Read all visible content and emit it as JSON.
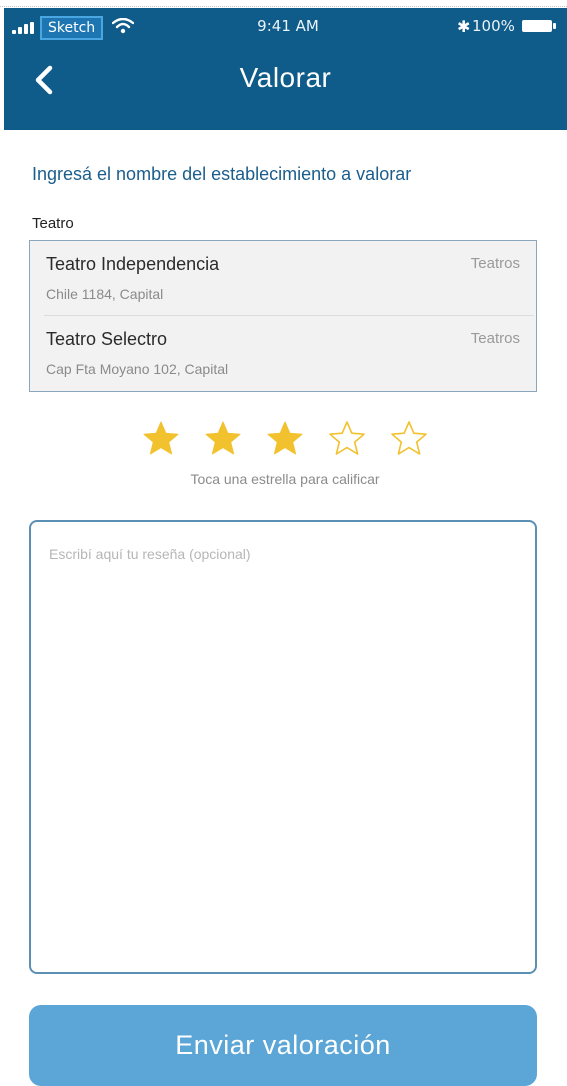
{
  "status_bar": {
    "carrier": "Sketch",
    "time": "9:41 AM",
    "battery": "100%"
  },
  "header": {
    "title": "Valorar",
    "back_icon": "chevron-left-icon"
  },
  "form": {
    "instructions": "Ingresá el nombre del establecimiento a valorar",
    "field_label": "Teatro",
    "results": [
      {
        "name": "Teatro Independencia",
        "address": "Chile 1184, Capital",
        "category": "Teatros"
      },
      {
        "name": "Teatro Selectro",
        "address": "Cap Fta Moyano 102, Capital",
        "category": "Teatros"
      }
    ],
    "rating": {
      "value": 3,
      "max": 5,
      "hint": "Toca una estrella para calificar",
      "filled_color": "#f2c12e",
      "empty_color": "#f2c12e"
    },
    "review": {
      "placeholder": "Escribí aquí tu reseña (opcional)",
      "value": ""
    },
    "submit_label": "Enviar valoración"
  },
  "colors": {
    "header": "#0f5b8a",
    "accent_text": "#1b5e8c",
    "button": "#5ba6d6",
    "input_border": "#5c8fb4"
  }
}
